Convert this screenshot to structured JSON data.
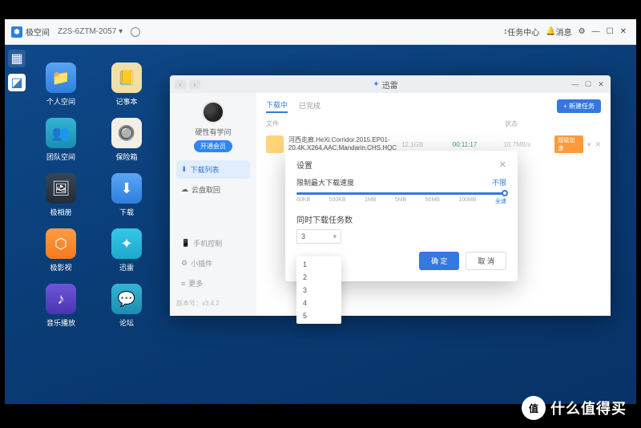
{
  "taskbar": {
    "brand": "极空间",
    "device": "Z2S-6ZTM-2057",
    "task_center": "任务中心",
    "messages": "消息"
  },
  "desktop": {
    "icons": [
      {
        "label": "个人空间",
        "cls": "c-blue",
        "glyph": "📁"
      },
      {
        "label": "记事本",
        "cls": "c-note",
        "glyph": "📒"
      },
      {
        "label": "团队空间",
        "cls": "c-teal",
        "glyph": "👥"
      },
      {
        "label": "保险箱",
        "cls": "c-white",
        "glyph": "🔘"
      },
      {
        "label": "极相册",
        "cls": "c-dark",
        "glyph": "🖼"
      },
      {
        "label": "下载",
        "cls": "c-blue",
        "glyph": "⬇"
      },
      {
        "label": "极影视",
        "cls": "c-orange",
        "glyph": "⬡"
      },
      {
        "label": "迅雷",
        "cls": "c-cyan",
        "glyph": "✦"
      },
      {
        "label": "音乐播放",
        "cls": "c-purple",
        "glyph": "♪"
      },
      {
        "label": "论坛",
        "cls": "c-teal",
        "glyph": "💬"
      }
    ]
  },
  "window": {
    "title": "迅雷",
    "sidebar": {
      "username": "硬性有学问",
      "open_vip": "开通会员",
      "items": [
        "下载列表",
        "云盘取回"
      ],
      "bottom": [
        "手机控制",
        "小插件",
        "更多"
      ],
      "version": "版本号：v3.4.2"
    },
    "content": {
      "tabs": [
        "下载中",
        "已完成"
      ],
      "new_task": "+ 新建任务",
      "columns": [
        "文件",
        "状态"
      ],
      "file": {
        "name": "河西走廊.HeXi.Corridor.2015.EP01-20.4K.X264.AAC.Mandarin.CHS.HQC",
        "size": "12.1GB",
        "time": "00:11:17",
        "speed": "10.7MB/s",
        "accel": "超级加速"
      }
    }
  },
  "modal": {
    "title": "设置",
    "speed_label": "限制最大下载速度",
    "speed_value": "不限",
    "speed_ticks": [
      "60KB",
      "500KB",
      "1MB",
      "5MB",
      "50MB",
      "100MB",
      "全速"
    ],
    "task_label": "同时下载任务数",
    "task_value": "3",
    "confirm": "确 定",
    "cancel": "取 消",
    "options": [
      "1",
      "2",
      "3",
      "4",
      "5"
    ]
  },
  "watermark": {
    "badge": "值",
    "text": "什么值得买"
  }
}
